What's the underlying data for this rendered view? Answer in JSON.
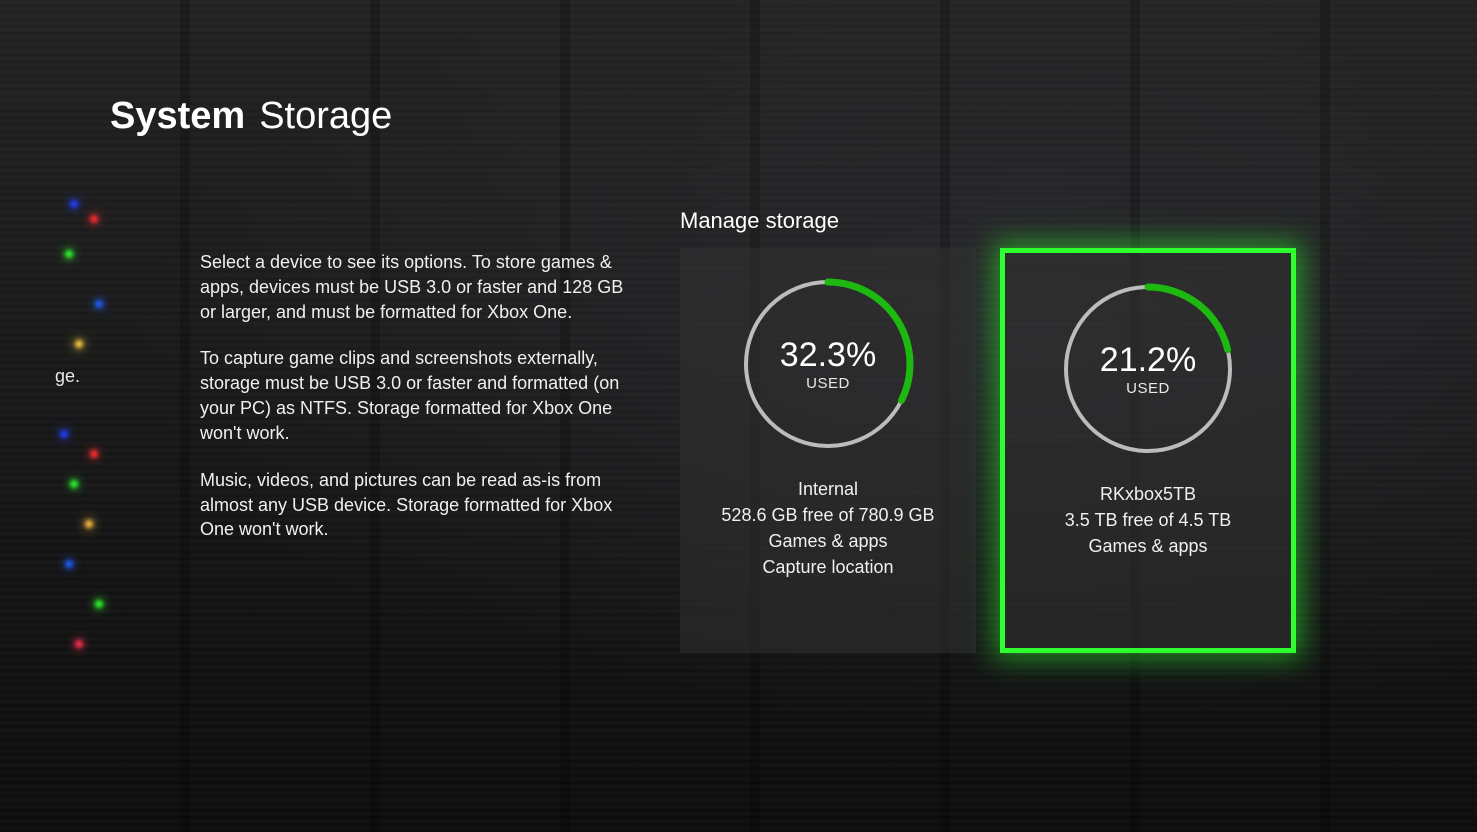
{
  "header": {
    "category": "System",
    "page": "Storage"
  },
  "sidebar_partial_label": "ge.",
  "section_header": "Manage storage",
  "description": {
    "p1": "Select a device to see its options. To store games & apps, devices must be USB 3.0 or faster and 128 GB or larger, and must be formatted for Xbox One.",
    "p2": "To capture game clips and screenshots externally, storage must be USB 3.0 or faster and formatted (on your PC) as NTFS. Storage formatted for Xbox One won't work.",
    "p3": "Music, videos, and pictures can be read as-is from almost any USB device. Storage formatted for Xbox One won't work."
  },
  "used_label": "USED",
  "colors": {
    "accent": "#1db910",
    "accent_bright": "#39ff39",
    "ring_track": "#bcbcbc"
  },
  "devices": [
    {
      "percent_used": 32.3,
      "percent_label": "32.3%",
      "name": "Internal",
      "free_line": "528.6 GB free of 780.9 GB",
      "role_line": "Games & apps",
      "extra_line": "Capture location",
      "selected": false
    },
    {
      "percent_used": 21.2,
      "percent_label": "21.2%",
      "name": "RKxbox5TB",
      "free_line": "3.5 TB free of 4.5 TB",
      "role_line": "Games & apps",
      "extra_line": "",
      "selected": true
    }
  ]
}
